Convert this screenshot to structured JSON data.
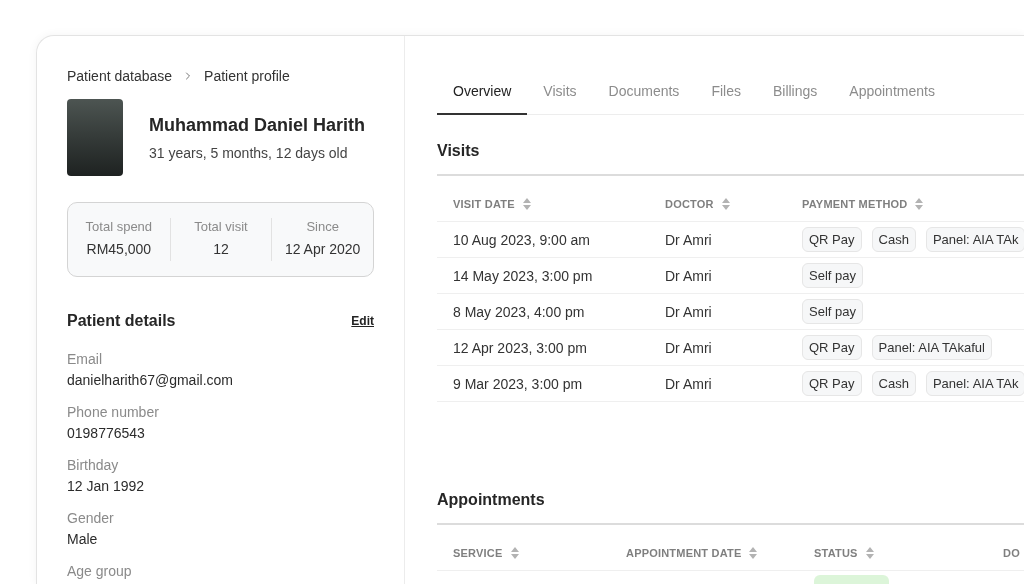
{
  "breadcrumb": [
    "Patient database",
    "Patient profile"
  ],
  "patient": {
    "name": "Muhammad Daniel Harith",
    "age": "31 years, 5 months, 12 days old"
  },
  "stats": [
    {
      "label": "Total spend",
      "value": "RM45,000"
    },
    {
      "label": "Total visit",
      "value": "12"
    },
    {
      "label": "Since",
      "value": "12 Apr 2020"
    }
  ],
  "details": {
    "title": "Patient details",
    "edit": "Edit",
    "fields": [
      {
        "label": "Email",
        "value": "danielharith67@gmail.com"
      },
      {
        "label": "Phone number",
        "value": "0198776543"
      },
      {
        "label": "Birthday",
        "value": "12 Jan 1992"
      },
      {
        "label": "Gender",
        "value": "Male"
      },
      {
        "label": "Age group"
      }
    ]
  },
  "tabs": [
    {
      "label": "Overview",
      "selected": true
    },
    {
      "label": "Visits",
      "selected": false
    },
    {
      "label": "Documents",
      "selected": false
    },
    {
      "label": "Files",
      "selected": false
    },
    {
      "label": "Billings",
      "selected": false
    },
    {
      "label": "Appointments",
      "selected": false
    }
  ],
  "visits": {
    "title": "Visits",
    "columns": [
      "VISIT DATE",
      "DOCTOR",
      "PAYMENT METHOD"
    ],
    "rows": [
      {
        "visit_date": "10 Aug 2023, 9:00 am",
        "doctor": "Dr Amri",
        "payment_methods": [
          "QR Pay",
          "Cash",
          "Panel: AIA TAk"
        ]
      },
      {
        "visit_date": "14 May 2023, 3:00 pm",
        "doctor": "Dr Amri",
        "payment_methods": [
          "Self pay"
        ]
      },
      {
        "visit_date": "8 May 2023, 4:00 pm",
        "doctor": "Dr Amri",
        "payment_methods": [
          "Self pay"
        ]
      },
      {
        "visit_date": "12 Apr 2023, 3:00 pm",
        "doctor": "Dr Amri",
        "payment_methods": [
          "QR Pay",
          "Panel: AIA TAkaful"
        ]
      },
      {
        "visit_date": "9 Mar 2023, 3:00 pm",
        "doctor": "Dr Amri",
        "payment_methods": [
          "QR Pay",
          "Cash",
          "Panel: AIA TAk"
        ]
      }
    ]
  },
  "appointments": {
    "title": "Appointments",
    "columns": [
      "SERVICE",
      "APPOINTMENT DATE",
      "STATUS",
      "DO"
    ],
    "rows": [
      {
        "status": {
          "color": "#dcf5d9"
        }
      }
    ]
  }
}
